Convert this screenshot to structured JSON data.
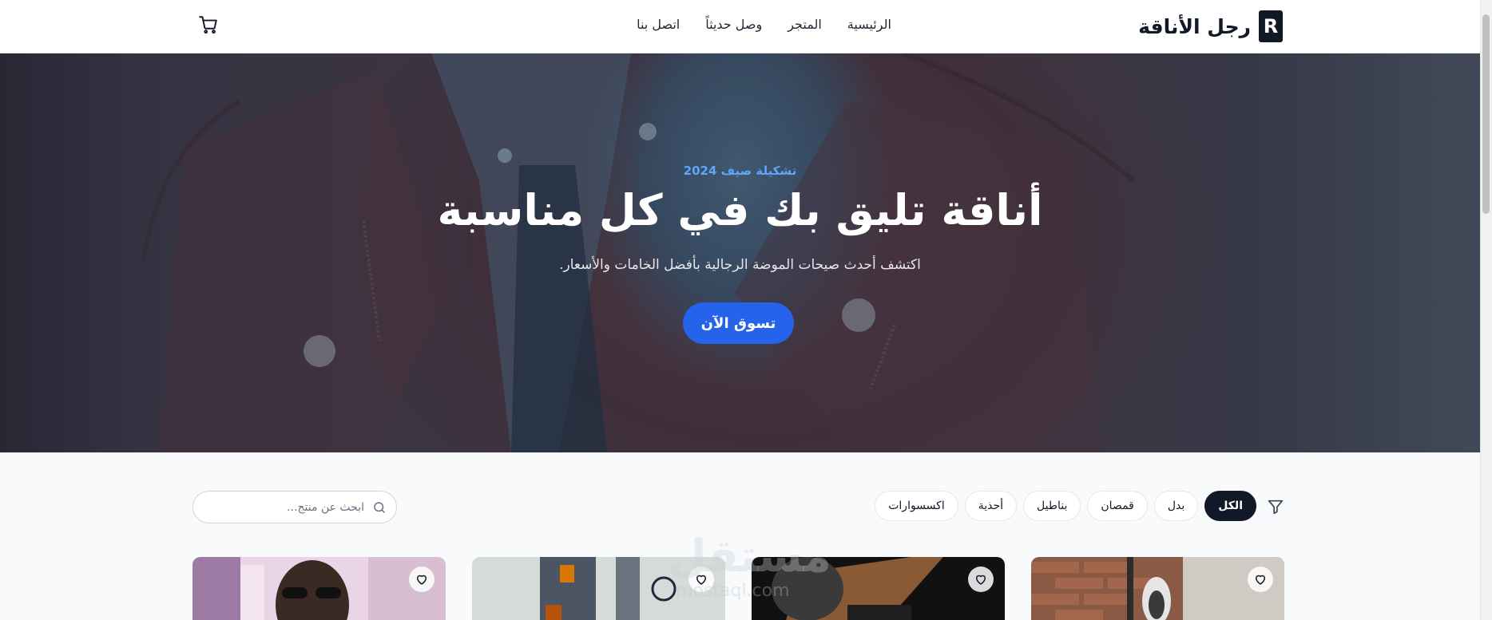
{
  "header": {
    "logo_letter": "R",
    "brand": "رجل الأناقة",
    "nav": [
      {
        "label": "الرئيسية"
      },
      {
        "label": "المتجر"
      },
      {
        "label": "وصل حديثاً"
      },
      {
        "label": "اتصل بنا"
      }
    ],
    "cart_icon": "shopping-cart-icon"
  },
  "hero": {
    "tag": "تشكيلة صيف 2024",
    "title": "أناقة تليق بك في كل مناسبة",
    "subtitle": "اكتشف أحدث صيحات الموضة الرجالية بأفضل الخامات والأسعار.",
    "cta": "تسوق الآن"
  },
  "filters": {
    "icon": "filter-icon",
    "categories": [
      {
        "label": "الكل",
        "active": true
      },
      {
        "label": "بدل",
        "active": false
      },
      {
        "label": "قمصان",
        "active": false
      },
      {
        "label": "بناطيل",
        "active": false
      },
      {
        "label": "أحذية",
        "active": false
      },
      {
        "label": "اكسسوارات",
        "active": false
      }
    ],
    "search_placeholder": "ابحث عن منتج..."
  },
  "products": [
    {
      "favorite_icon": "heart-icon"
    },
    {
      "favorite_icon": "heart-icon"
    },
    {
      "favorite_icon": "heart-icon"
    },
    {
      "favorite_icon": "heart-icon"
    }
  ],
  "watermark": {
    "text": "مستقل",
    "sub": "mostaql.com"
  },
  "colors": {
    "primary": "#2563eb",
    "dark": "#111827",
    "accent_tag": "#60a5fa"
  }
}
